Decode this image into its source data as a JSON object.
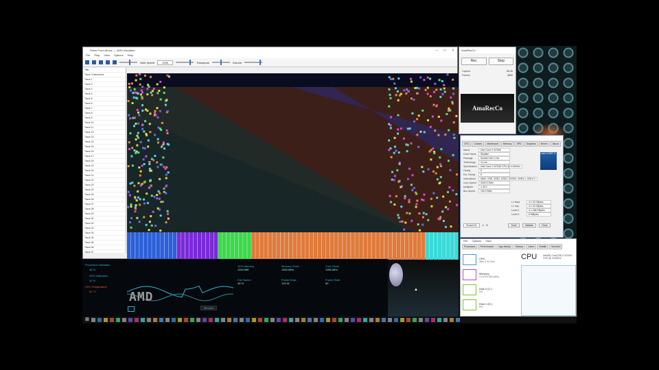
{
  "visualizer": {
    "title": "Piano From Above — MIDI Visualizer",
    "menu": [
      "File",
      "Play",
      "View",
      "Options",
      "Help"
    ],
    "toolbar": {
      "label_a": "Note Speed",
      "value_a": "1000",
      "label_b": "Transpose",
      "label_c": "Volume"
    },
    "tracks": [
      "Title",
      "Track / Instrument",
      "Track 1",
      "Track 2",
      "Track 3",
      "Track 4",
      "Track 5",
      "Track 6",
      "Track 7",
      "Track 8",
      "Track 9",
      "Track 10",
      "Track 11",
      "Track 12",
      "Track 13",
      "Track 14",
      "Track 15",
      "Track 16",
      "Track 17",
      "Track 18",
      "Track 19",
      "Track 20",
      "Track 21",
      "Track 22",
      "Track 23",
      "Track 24",
      "Track 25",
      "Track 26",
      "Track 27",
      "Track 28",
      "Track 29",
      "Track 30",
      "Track 31",
      "Track 32",
      "Track 33",
      "Track 34",
      "Track 35",
      "Track 36",
      "Track 37",
      "Track 38",
      "Track 39",
      "Track 40"
    ]
  },
  "hw_monitor": {
    "cpu_label": "Processor Utilization",
    "cpu_value": "48 %",
    "gpu_label": "GPU Utilization",
    "gpu_value": "32 %",
    "temp_label": "CPU Temperature",
    "temp_value": "62 °C",
    "stats": [
      {
        "label": "GPU Memory",
        "value": "1024 MB"
      },
      {
        "label": "Memory Clock",
        "value": "1500 MHz"
      },
      {
        "label": "Core Clock",
        "value": "1050 MHz"
      },
      {
        "label": "Fan Speed",
        "value": "45 %"
      },
      {
        "label": "Power Draw",
        "value": "120 W"
      },
      {
        "label": "Frame Rate",
        "value": "60"
      }
    ],
    "logo": "AMD",
    "dropdown": "Minutes"
  },
  "recorder": {
    "title": "AmaRecCo",
    "buttons": [
      "Rec",
      "Stop"
    ],
    "fields": [
      {
        "label": "Capture",
        "value": "60.00"
      },
      {
        "label": "Frames",
        "value": "3600"
      }
    ],
    "logo": "AmaRecCo"
  },
  "cpuz": {
    "tabs": [
      "CPU",
      "Caches",
      "Mainboard",
      "Memory",
      "SPD",
      "Graphics",
      "Bench",
      "About"
    ],
    "rows": [
      {
        "label": "Name",
        "value": "Intel Core i7 6700K"
      },
      {
        "label": "Code Name",
        "value": "Skylake"
      },
      {
        "label": "Package",
        "value": "Socket 1151 LGA"
      },
      {
        "label": "Technology",
        "value": "14 nm"
      },
      {
        "label": "Specification",
        "value": "Intel Core i7-6700K CPU @ 4.00GHz"
      },
      {
        "label": "Family",
        "value": "6"
      },
      {
        "label": "Ext. Family",
        "value": "6"
      },
      {
        "label": "Instructions",
        "value": "MMX, SSE, SSE2, SSE3, SSSE3, SSE4.1, SSE4.2"
      },
      {
        "label": "Core Speed",
        "value": "4000.0 MHz"
      },
      {
        "label": "Multiplier",
        "value": "x 40.0"
      },
      {
        "label": "Bus Speed",
        "value": "100.0 MHz"
      }
    ],
    "cache": [
      {
        "label": "L1 Data",
        "value": "4 x 32 KBytes"
      },
      {
        "label": "L1 Inst.",
        "value": "4 x 32 KBytes"
      },
      {
        "label": "Level 2",
        "value": "4 x 256 KBytes"
      },
      {
        "label": "Level 3",
        "value": "8 MBytes"
      }
    ],
    "footer": {
      "selection": "Socket #1",
      "cores": "4",
      "threads": "8",
      "tools": "Tools",
      "validate": "Validate",
      "close": "Close"
    },
    "badge": "intel CORE i7"
  },
  "taskmgr": {
    "menu": [
      "File",
      "Options",
      "View"
    ],
    "tabs": [
      "Processes",
      "Performance",
      "App history",
      "Startup",
      "Users",
      "Details",
      "Services"
    ],
    "items": [
      {
        "name": "CPU",
        "detail": "48% 4.00 GHz",
        "color": "#4a90e2"
      },
      {
        "name": "Memory",
        "detail": "4.1/15.9 GB (26%)",
        "color": "#b04ac9"
      },
      {
        "name": "Disk 0 (C:)",
        "detail": "0%",
        "color": "#7bbf3a"
      },
      {
        "name": "Disk 1 (D:)",
        "detail": "0%",
        "color": "#7bbf3a"
      }
    ],
    "heading": "CPU",
    "subheading": "Intel(R) Core(TM) i7-6700K CPU @ 4.00GHz"
  },
  "colors": {
    "cyan": "#2fb8d8",
    "orange": "#e36b2b",
    "roll_bg": "#0a0d20"
  }
}
